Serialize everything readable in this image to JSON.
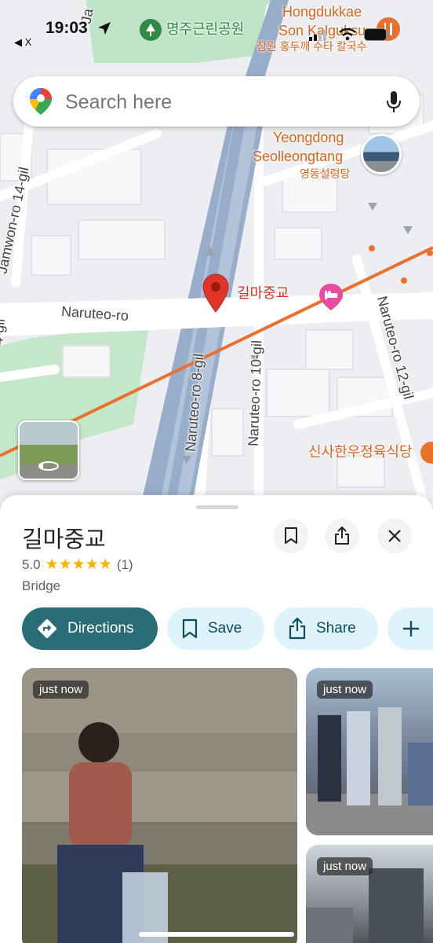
{
  "status_bar": {
    "time": "19:03",
    "back_label": "◀ X"
  },
  "search": {
    "placeholder": "Search here"
  },
  "map": {
    "park_label": "명주근린공원",
    "poi_top_en_1": "Hongdukkae",
    "poi_top_en_2": "Son Kalguksu",
    "poi_top_kr": "잠원 홍두깨 수타 칼국수",
    "poi_right_en_1": "Yeongdong",
    "poi_right_en_2": "Seolleongtang",
    "poi_right_kr": "영동설렁탕",
    "pin_label": "길마중교",
    "restaurant_bottom": "신사한우정육식당",
    "roads": {
      "jamwon14": "Jamwon-ro 14-gil",
      "naruteo": "Naruteo-ro",
      "naruteo8": "Naruteo-ro 8-gil",
      "naruteo10": "Naruteo-ro 10-gil",
      "naruteo12": "Naruteo-ro 12-gil",
      "left_cut": "4-gil",
      "top_cut": "Ja"
    }
  },
  "sheet": {
    "title": "길마중교",
    "rating_value": "5.0",
    "stars": "★★★★★",
    "review_count": "(1)",
    "category": "Bridge",
    "actions": {
      "directions": "Directions",
      "save": "Save",
      "share": "Share"
    },
    "photos": [
      {
        "badge": "just now"
      },
      {
        "badge": "just now"
      },
      {
        "badge": "just now"
      }
    ]
  },
  "colors": {
    "accent_dark": "#2a6c78",
    "accent_light": "#dff3fb",
    "pin_red": "#e1352a",
    "hotel_pink": "#e84ba0",
    "rail_orange": "#e9712d"
  }
}
